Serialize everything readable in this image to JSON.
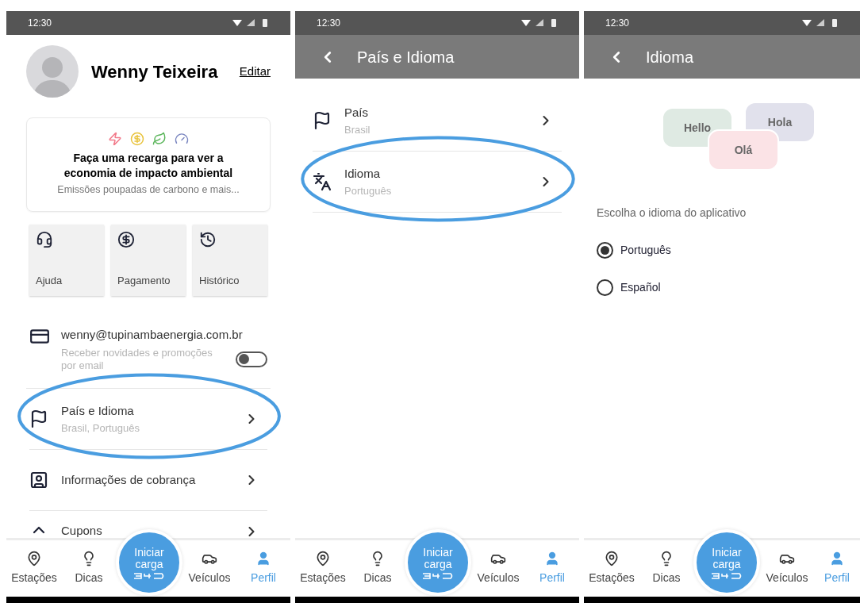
{
  "profile_screen": {
    "status_bar": {
      "time": "12:30"
    },
    "user": {
      "name": "Wenny Teixeira",
      "edit_link": "Editar"
    },
    "impact_card": {
      "title": "Faça uma recarga para ver a economia de impacto ambiental",
      "subtitle": "Emissões poupadas de carbono e mais..."
    },
    "tiles": [
      {
        "kind": "help",
        "label": "Ajuda"
      },
      {
        "kind": "payment",
        "label": "Pagamento"
      },
      {
        "kind": "history",
        "label": "Histórico"
      }
    ],
    "email": {
      "address": "wenny@tupinambaenergia.com.br",
      "newsletter_label": "Receber novidades e promoções por email",
      "on": false
    },
    "menu": [
      {
        "kind": "flag",
        "title": "País e Idioma",
        "subtitle": "Brasil, Português",
        "highlighted": true
      },
      {
        "kind": "contact",
        "title": "Informações de cobrança",
        "highlighted": false
      },
      {
        "kind": "coupon",
        "title": "Cupons",
        "highlighted": false
      }
    ],
    "bottom_nav": {
      "items": [
        {
          "kind": "station",
          "label": "Estações",
          "selected": false
        },
        {
          "kind": "tips",
          "label": "Dicas",
          "selected": false
        },
        {
          "kind": "vehicle",
          "label": "Veículos",
          "selected": false
        },
        {
          "kind": "profile",
          "label": "Perfil",
          "selected": true
        }
      ],
      "center_button": "Iniciar carga"
    }
  },
  "country_language_screen": {
    "status_bar": {
      "time": "12:30"
    },
    "header": {
      "title": "País e Idioma"
    },
    "menu": [
      {
        "kind": "flag",
        "title": "País",
        "subtitle": "Brasil",
        "highlighted": false
      },
      {
        "kind": "language",
        "title": "Idioma",
        "subtitle": "Português",
        "highlighted": true
      }
    ],
    "bottom_nav": {
      "items": [
        {
          "kind": "station",
          "label": "Estações",
          "selected": false
        },
        {
          "kind": "tips",
          "label": "Dicas",
          "selected": false
        },
        {
          "kind": "vehicle",
          "label": "Veículos",
          "selected": false
        },
        {
          "kind": "profile",
          "label": "Perfil",
          "selected": true
        }
      ],
      "center_button": "Iniciar carga"
    }
  },
  "language_screen": {
    "status_bar": {
      "time": "12:30"
    },
    "header": {
      "title": "Idioma"
    },
    "bubbles": [
      {
        "text": "Hello",
        "color": "#dfeae3"
      },
      {
        "text": "Hola",
        "color": "#e1e1ec"
      },
      {
        "text": "Olá",
        "color": "#fbe3e6"
      }
    ],
    "prompt": "Escolha o idioma do aplicativo",
    "options": [
      {
        "label": "Português",
        "selected": true
      },
      {
        "label": "Español",
        "selected": false
      }
    ],
    "bottom_nav": {
      "items": [
        {
          "kind": "station",
          "label": "Estações",
          "selected": false
        },
        {
          "kind": "tips",
          "label": "Dicas",
          "selected": false
        },
        {
          "kind": "vehicle",
          "label": "Veículos",
          "selected": false
        },
        {
          "kind": "profile",
          "label": "Perfil",
          "selected": true
        }
      ],
      "center_button": "Iniciar carga"
    }
  }
}
